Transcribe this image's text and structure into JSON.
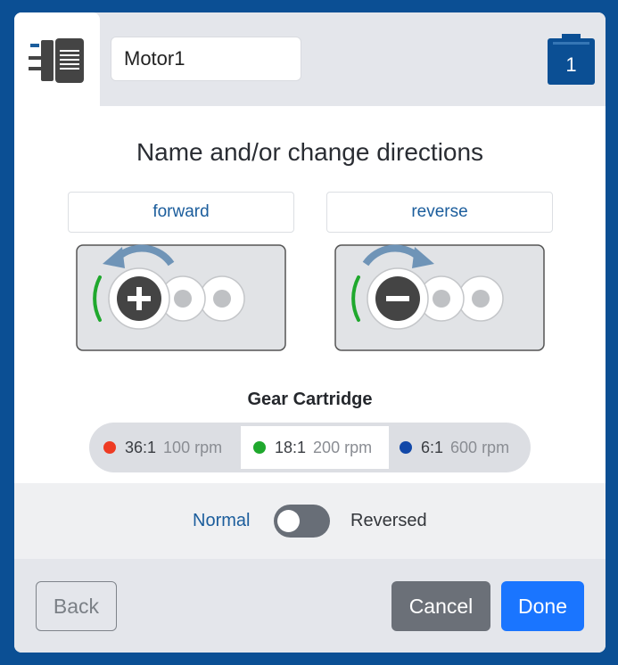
{
  "header": {
    "motor_icon": "motor-icon",
    "motor_name_value": "Motor1",
    "port_number": "1"
  },
  "main": {
    "title": "Name and/or change directions",
    "directions": [
      {
        "label": "forward",
        "icon": "plus-icon",
        "arrow": "counterclockwise-arrow-icon"
      },
      {
        "label": "reverse",
        "icon": "minus-icon",
        "arrow": "clockwise-arrow-icon"
      }
    ]
  },
  "gear_cartridge": {
    "label": "Gear Cartridge",
    "selected_index": 1,
    "options": [
      {
        "ratio": "36:1",
        "rpm": "100 rpm",
        "color": "#ee3b23"
      },
      {
        "ratio": "18:1",
        "rpm": "200 rpm",
        "color": "#1fa82d"
      },
      {
        "ratio": "6:1",
        "rpm": "600 rpm",
        "color": "#1248a8"
      }
    ]
  },
  "direction_toggle": {
    "left_label": "Normal",
    "right_label": "Reversed",
    "reversed": false
  },
  "footer": {
    "back_label": "Back",
    "cancel_label": "Cancel",
    "done_label": "Done"
  },
  "colors": {
    "frame": "#0b4f94",
    "accent_text": "#1b5d9c",
    "done_button": "#1a75ff",
    "cancel_button": "#6b7078",
    "port_badge": "#0b4f94"
  }
}
